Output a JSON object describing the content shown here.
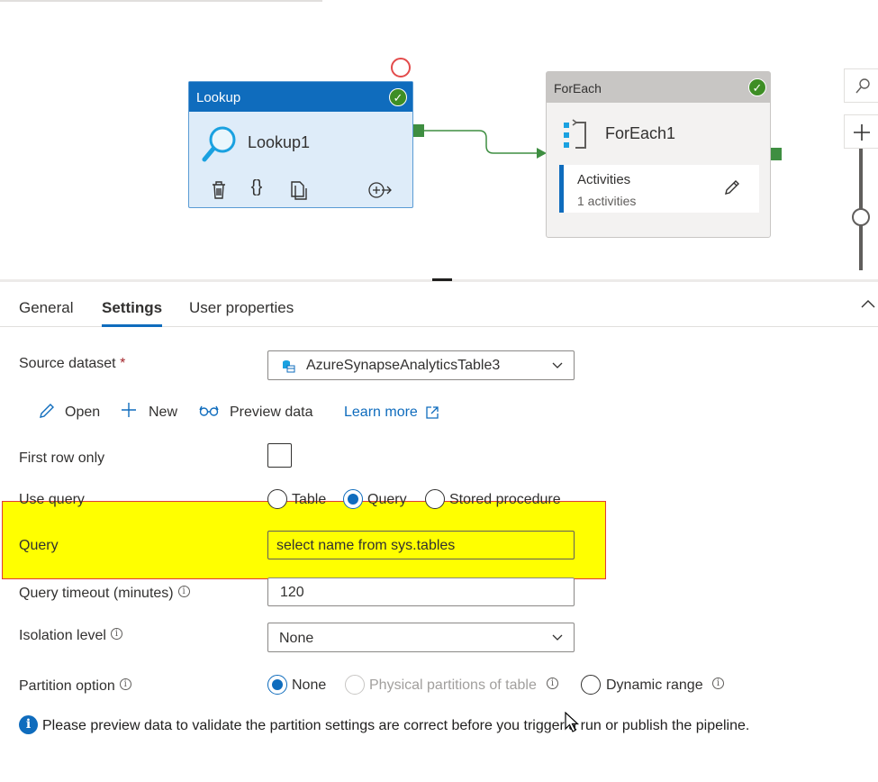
{
  "canvas": {
    "lookup_activity": {
      "type_label": "Lookup",
      "name": "Lookup1",
      "status": "succeeded"
    },
    "foreach_activity": {
      "type_label": "ForEach",
      "name": "ForEach1",
      "status": "succeeded",
      "inner_title": "Activities",
      "inner_count": "1 activities"
    }
  },
  "tabs": [
    {
      "label": "General",
      "active": false
    },
    {
      "label": "Settings",
      "active": true
    },
    {
      "label": "User properties",
      "active": false
    }
  ],
  "settings": {
    "source_dataset": {
      "label": "Source dataset",
      "required_mark": "*",
      "value": "AzureSynapseAnalyticsTable3"
    },
    "actions": {
      "open": "Open",
      "new": "New",
      "preview": "Preview data",
      "learn_more": "Learn more"
    },
    "first_row_only": {
      "label": "First row only",
      "checked": false
    },
    "use_query": {
      "label": "Use query",
      "options": [
        "Table",
        "Query",
        "Stored procedure"
      ],
      "selected": "Query"
    },
    "query": {
      "label": "Query",
      "value": "select name from sys.tables"
    },
    "query_timeout": {
      "label": "Query timeout (minutes)",
      "value": "120"
    },
    "isolation_level": {
      "label": "Isolation level",
      "value": "None"
    },
    "partition_option": {
      "label": "Partition option",
      "options": [
        "None",
        "Physical partitions of table",
        "Dynamic range"
      ],
      "selected": "None",
      "disabled": [
        "Physical partitions of table"
      ]
    },
    "info_message": "Please preview data to validate the partition settings are correct before you trigger a run or publish the pipeline."
  },
  "colors": {
    "accent": "#0f6cbd",
    "success": "#3e8e25",
    "highlight": "#ffff00",
    "highlight_border": "#e03a3a"
  }
}
